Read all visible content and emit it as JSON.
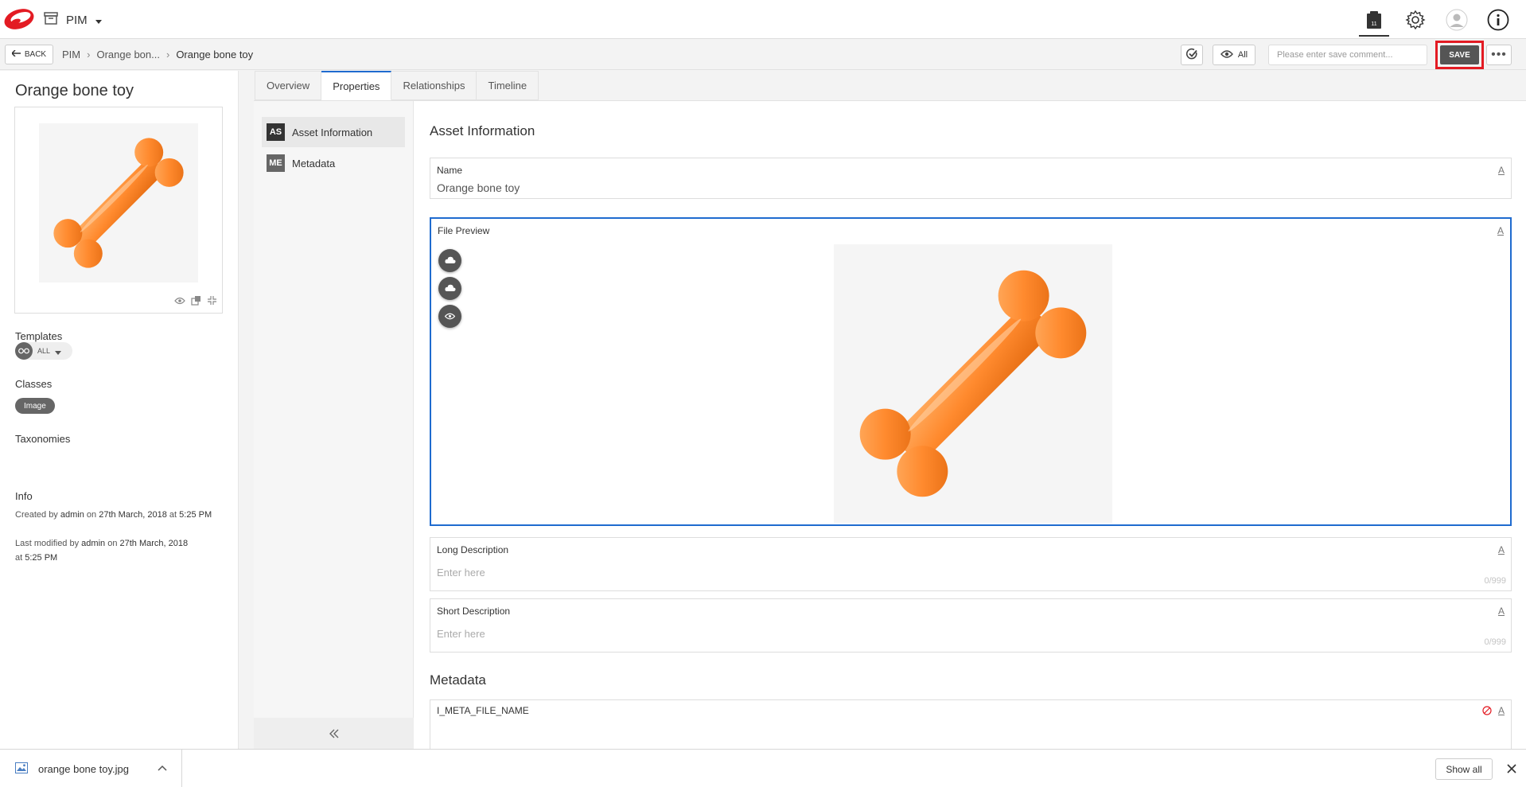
{
  "header": {
    "logo_icon": "brand-logo-icon",
    "app_switch_label": "PIM",
    "brand_color": "#e31b23",
    "accent_color": "#1f6bcf"
  },
  "breadcrumb": {
    "back_label": "BACK",
    "items": [
      "PIM",
      "Orange bon...",
      "Orange bone toy"
    ]
  },
  "toolbar": {
    "view_label": "All",
    "comment_placeholder": "Please enter save comment...",
    "save_label": "SAVE",
    "more_label": "•••"
  },
  "sidebar": {
    "title": "Orange bone toy",
    "templates_label": "Templates",
    "template_value": "ALL",
    "classes_label": "Classes",
    "class_badge": "Image",
    "taxonomies_label": "Taxonomies",
    "info_label": "Info",
    "created": {
      "prefix": "Created by",
      "user": "admin",
      "on": "on",
      "date": "27th March, 2018",
      "at": "at",
      "time": "5:25 PM"
    },
    "modified": {
      "prefix": "Last modified by",
      "user": "admin",
      "on": "on",
      "date": "27th March, 2018",
      "at": "at",
      "time": "5:25 PM"
    }
  },
  "tabs": [
    {
      "label": "Overview",
      "active": false
    },
    {
      "label": "Properties",
      "active": true
    },
    {
      "label": "Relationships",
      "active": false
    },
    {
      "label": "Timeline",
      "active": false
    }
  ],
  "section_nav": [
    {
      "abbrev": "AS",
      "label": "Asset Information",
      "active": true
    },
    {
      "abbrev": "ME",
      "label": "Metadata",
      "active": false
    }
  ],
  "form": {
    "asset_heading": "Asset Information",
    "name_label": "Name",
    "name_value": "Orange bone toy",
    "file_preview_label": "File Preview",
    "long_desc_label": "Long Description",
    "long_desc_placeholder": "Enter here",
    "long_desc_counter": "0/999",
    "short_desc_label": "Short Description",
    "short_desc_placeholder": "Enter here",
    "short_desc_counter": "0/999",
    "metadata_heading": "Metadata",
    "meta_field_label": "I_META_FILE_NAME",
    "flag_glyph": "A"
  },
  "download_bar": {
    "file_name": "orange bone toy.jpg",
    "show_all_label": "Show all"
  }
}
